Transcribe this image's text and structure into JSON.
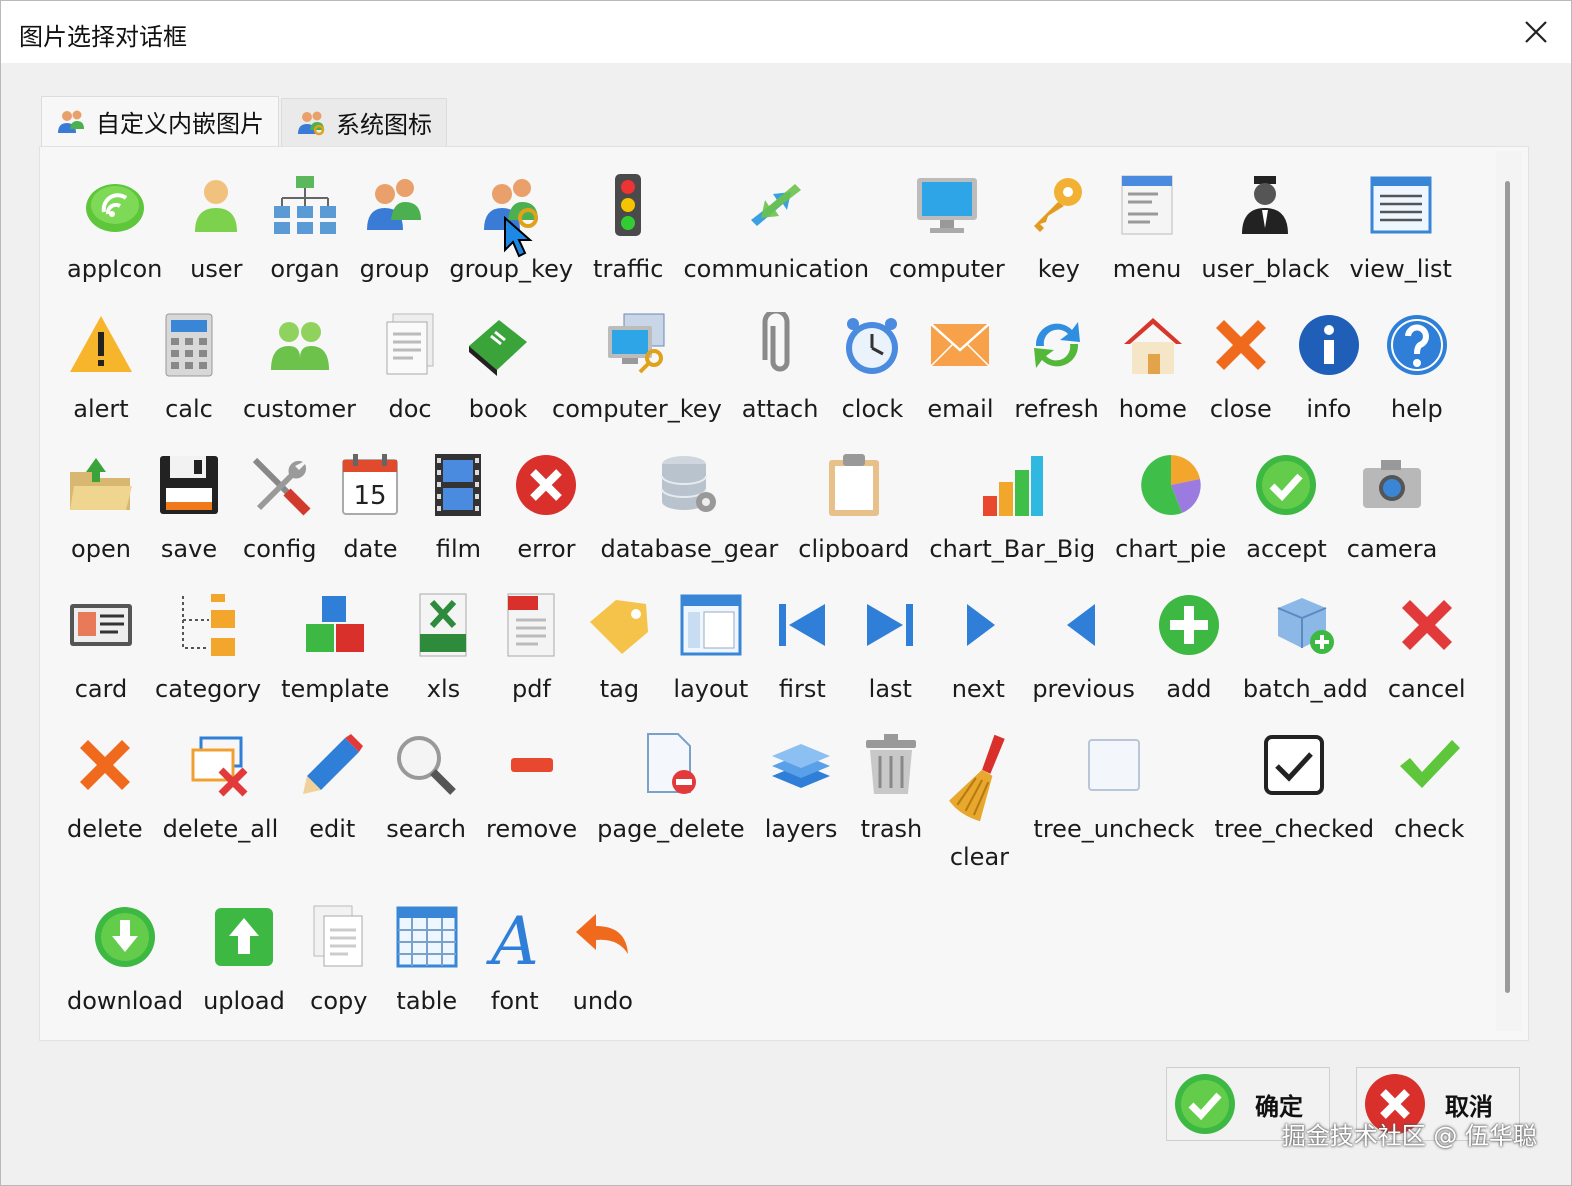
{
  "window": {
    "title": "图片选择对话框"
  },
  "tabs": [
    {
      "label": "自定义内嵌图片",
      "icon": "users-icon",
      "active": true
    },
    {
      "label": "系统图标",
      "icon": "users-key-icon",
      "active": false
    }
  ],
  "icons": {
    "row1": [
      "appIcon",
      "user",
      "organ",
      "group",
      "group_key",
      "traffic",
      "communication",
      "computer",
      "key",
      "menu",
      "user_black",
      "view_list"
    ],
    "row2": [
      "alert",
      "calc",
      "customer",
      "doc",
      "book",
      "computer_key",
      "attach",
      "clock",
      "email",
      "refresh",
      "home",
      "close",
      "info",
      "help"
    ],
    "row3": [
      "open",
      "save",
      "config",
      "date",
      "film",
      "error",
      "database_gear",
      "clipboard",
      "chart_Bar_Big",
      "chart_pie",
      "accept",
      "camera"
    ],
    "row4": [
      "card",
      "category",
      "template",
      "xls",
      "pdf",
      "tag",
      "layout",
      "first",
      "last",
      "next",
      "previous",
      "add",
      "batch_add",
      "cancel"
    ],
    "row5": [
      "delete",
      "delete_all",
      "edit",
      "search",
      "remove",
      "page_delete",
      "layers",
      "trash",
      "clear",
      "tree_uncheck",
      "tree_checked",
      "check"
    ],
    "row6": [
      "download",
      "upload",
      "copy",
      "table",
      "font",
      "undo"
    ]
  },
  "date_icon_text": "15",
  "buttons": {
    "ok": "确定",
    "cancel": "取消"
  },
  "watermark": "掘金技术社区 @ 伍华聪",
  "colors": {
    "green": "#3db843",
    "red": "#e2393a",
    "orange": "#f06a1d",
    "blue": "#2f7fd8"
  }
}
